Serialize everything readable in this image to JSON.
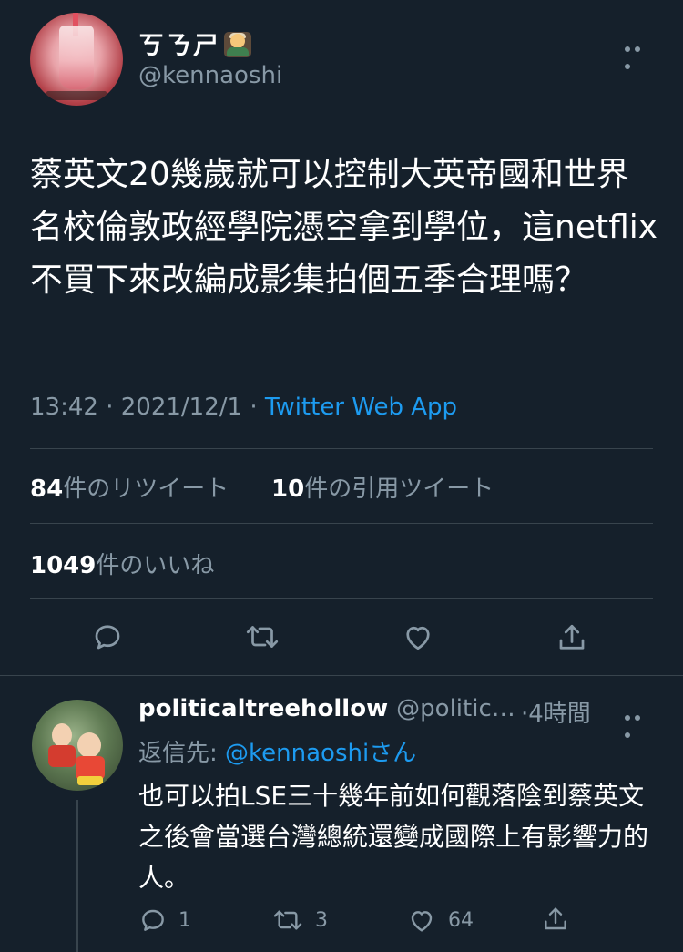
{
  "tweet": {
    "display_name": "ㄎㄋㄕ",
    "handle": "@kennaoshi",
    "text": "蔡英文20幾歲就可以控制大英帝國和世界名校倫敦政經學院憑空拿到學位，這netflix不買下來改編成影集拍個五季合理嗎？",
    "time": "13:42",
    "date": "2021/12/1",
    "separator": "·",
    "source": "Twitter Web App",
    "retweets_count": "84",
    "retweets_label": "件のリツイート",
    "quotes_count": "10",
    "quotes_label": "件の引用ツイート",
    "likes_count": "1049",
    "likes_label": "件のいいね",
    "actions": {
      "reply": "reply-icon",
      "retweet": "retweet-icon",
      "like": "heart-icon",
      "share": "share-icon"
    }
  },
  "reply": {
    "display_name": "politicaltreehollow",
    "handle": "@politic…",
    "time": "·4時間",
    "replying_prefix": "返信先: ",
    "replying_to": "@kennaoshiさん",
    "text": "也可以拍LSE三十幾年前如何觀落陰到蔡英文之後會當選台灣總統還變成國際上有影響力的人。",
    "reply_count": "1",
    "retweet_count": "3",
    "like_count": "64"
  },
  "colors": {
    "background": "#15202b",
    "accent": "#1d9bf0",
    "secondary_text": "#8899a6",
    "divider": "#38444d"
  }
}
